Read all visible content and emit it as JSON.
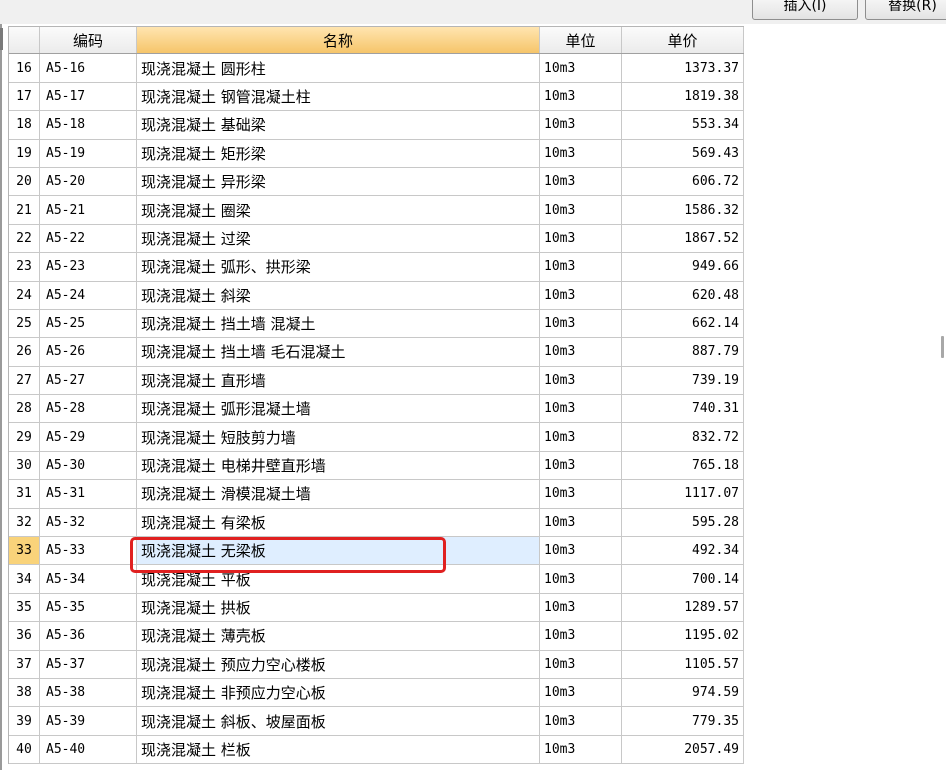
{
  "toolbar": {
    "insert_label": "插入(I)",
    "replace_label": "替换(R)"
  },
  "table": {
    "headers": {
      "no": "",
      "code": "编码",
      "name": "名称",
      "unit": "单位",
      "price": "单价"
    },
    "selected_index": 17,
    "rows": [
      {
        "no": "16",
        "code": "A5-16",
        "name": "现浇混凝土 圆形柱",
        "unit": "10m3",
        "price": "1373.37"
      },
      {
        "no": "17",
        "code": "A5-17",
        "name": "现浇混凝土 钢管混凝土柱",
        "unit": "10m3",
        "price": "1819.38"
      },
      {
        "no": "18",
        "code": "A5-18",
        "name": "现浇混凝土 基础梁",
        "unit": "10m3",
        "price": "553.34"
      },
      {
        "no": "19",
        "code": "A5-19",
        "name": "现浇混凝土 矩形梁",
        "unit": "10m3",
        "price": "569.43"
      },
      {
        "no": "20",
        "code": "A5-20",
        "name": "现浇混凝土 异形梁",
        "unit": "10m3",
        "price": "606.72"
      },
      {
        "no": "21",
        "code": "A5-21",
        "name": "现浇混凝土 圈梁",
        "unit": "10m3",
        "price": "1586.32"
      },
      {
        "no": "22",
        "code": "A5-22",
        "name": "现浇混凝土 过梁",
        "unit": "10m3",
        "price": "1867.52"
      },
      {
        "no": "23",
        "code": "A5-23",
        "name": "现浇混凝土 弧形、拱形梁",
        "unit": "10m3",
        "price": "949.66"
      },
      {
        "no": "24",
        "code": "A5-24",
        "name": "现浇混凝土 斜梁",
        "unit": "10m3",
        "price": "620.48"
      },
      {
        "no": "25",
        "code": "A5-25",
        "name": "现浇混凝土 挡土墙 混凝土",
        "unit": "10m3",
        "price": "662.14"
      },
      {
        "no": "26",
        "code": "A5-26",
        "name": "现浇混凝土 挡土墙 毛石混凝土",
        "unit": "10m3",
        "price": "887.79"
      },
      {
        "no": "27",
        "code": "A5-27",
        "name": "现浇混凝土 直形墙",
        "unit": "10m3",
        "price": "739.19"
      },
      {
        "no": "28",
        "code": "A5-28",
        "name": "现浇混凝土 弧形混凝土墙",
        "unit": "10m3",
        "price": "740.31"
      },
      {
        "no": "29",
        "code": "A5-29",
        "name": "现浇混凝土 短肢剪力墙",
        "unit": "10m3",
        "price": "832.72"
      },
      {
        "no": "30",
        "code": "A5-30",
        "name": "现浇混凝土 电梯井壁直形墙",
        "unit": "10m3",
        "price": "765.18"
      },
      {
        "no": "31",
        "code": "A5-31",
        "name": "现浇混凝土 滑模混凝土墙",
        "unit": "10m3",
        "price": "1117.07"
      },
      {
        "no": "32",
        "code": "A5-32",
        "name": "现浇混凝土 有梁板",
        "unit": "10m3",
        "price": "595.28"
      },
      {
        "no": "33",
        "code": "A5-33",
        "name": "现浇混凝土 无梁板",
        "unit": "10m3",
        "price": "492.34"
      },
      {
        "no": "34",
        "code": "A5-34",
        "name": "现浇混凝土 平板",
        "unit": "10m3",
        "price": "700.14"
      },
      {
        "no": "35",
        "code": "A5-35",
        "name": "现浇混凝土 拱板",
        "unit": "10m3",
        "price": "1289.57"
      },
      {
        "no": "36",
        "code": "A5-36",
        "name": "现浇混凝土 薄壳板",
        "unit": "10m3",
        "price": "1195.02"
      },
      {
        "no": "37",
        "code": "A5-37",
        "name": "现浇混凝土 预应力空心楼板",
        "unit": "10m3",
        "price": "1105.57"
      },
      {
        "no": "38",
        "code": "A5-38",
        "name": "现浇混凝土 非预应力空心板",
        "unit": "10m3",
        "price": "974.59"
      },
      {
        "no": "39",
        "code": "A5-39",
        "name": "现浇混凝土 斜板、坡屋面板",
        "unit": "10m3",
        "price": "779.35"
      },
      {
        "no": "40",
        "code": "A5-40",
        "name": "现浇混凝土 栏板",
        "unit": "10m3",
        "price": "2057.49"
      }
    ]
  },
  "colors": {
    "selected_row_number_bg": "#f9d37a",
    "selected_name_bg": "#dfeeff",
    "highlight_border": "#e02020",
    "name_header_bg": "#f6c56a"
  }
}
